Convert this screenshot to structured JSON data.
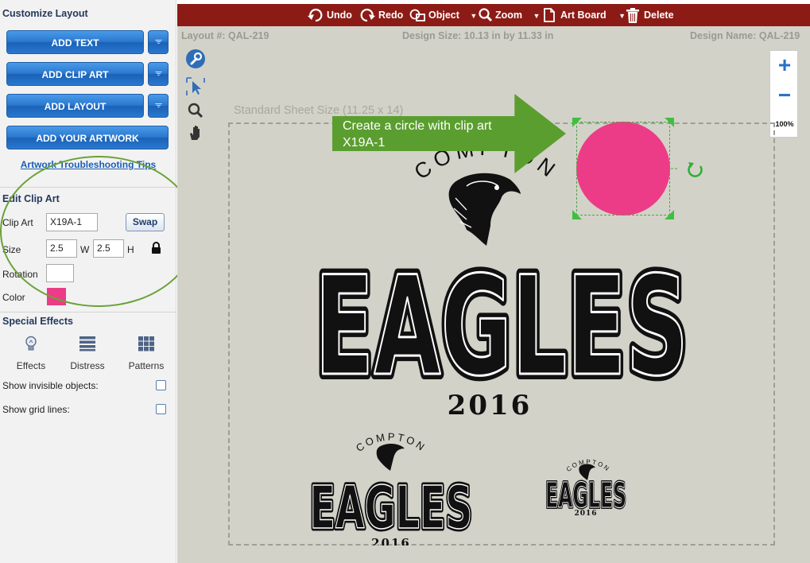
{
  "sidebar": {
    "customize_title": "Customize Layout",
    "buttons": {
      "add_text": "ADD TEXT",
      "add_clip_art": "ADD CLIP ART",
      "add_layout": "ADD LAYOUT",
      "add_artwork": "ADD YOUR ARTWORK"
    },
    "tips_link": "Artwork Troubleshooting Tips",
    "edit_clip_art": {
      "title": "Edit Clip Art",
      "clip_art_label": "Clip Art",
      "clip_art_value": "X19A-1",
      "swap_label": "Swap",
      "size_label": "Size",
      "width_value": "2.5",
      "w_label": "W",
      "height_value": "2.5",
      "h_label": "H",
      "rotation_label": "Rotation",
      "rotation_value": "",
      "color_label": "Color",
      "color_value": "#ec3c87"
    },
    "special_effects": {
      "title": "Special Effects",
      "effects": "Effects",
      "distress": "Distress",
      "patterns": "Patterns"
    },
    "show_invisible_label": "Show invisible objects:",
    "show_invisible_checked": false,
    "show_grid_label": "Show grid lines:",
    "show_grid_checked": false
  },
  "toolbar": {
    "undo": "Undo",
    "redo": "Redo",
    "object": "Object",
    "zoom": "Zoom",
    "art_board": "Art Board",
    "delete": "Delete"
  },
  "info": {
    "layout_number": "Layout #: QAL-219",
    "design_size": "Design Size: 10.13 in by 11.33 in",
    "design_name": "Design Name: QAL-219"
  },
  "canvas": {
    "sheet_label": "Standard Sheet Size (11.25 x 14)",
    "zoom_level": "100%",
    "callout_text": "Create a circle with clip art X19A-1"
  },
  "artwork": {
    "main": {
      "top_text": "COMPTON",
      "title": "EAGLES",
      "year": "2016"
    },
    "small_left": {
      "top_text": "COMPTON",
      "title": "EAGLES",
      "year": "2016"
    },
    "small_right": {
      "top_text": "COMPTON",
      "title": "EAGLES",
      "year": "2016"
    }
  },
  "icons": [
    "undo-icon",
    "redo-icon",
    "object-icon",
    "zoom-icon",
    "art-board-icon",
    "trash-icon",
    "wrench-icon",
    "pointer-icon",
    "magnifier-icon",
    "hand-icon",
    "lock-icon",
    "lightbulb-icon",
    "distress-icon",
    "patterns-icon",
    "rotate-handle-icon"
  ]
}
